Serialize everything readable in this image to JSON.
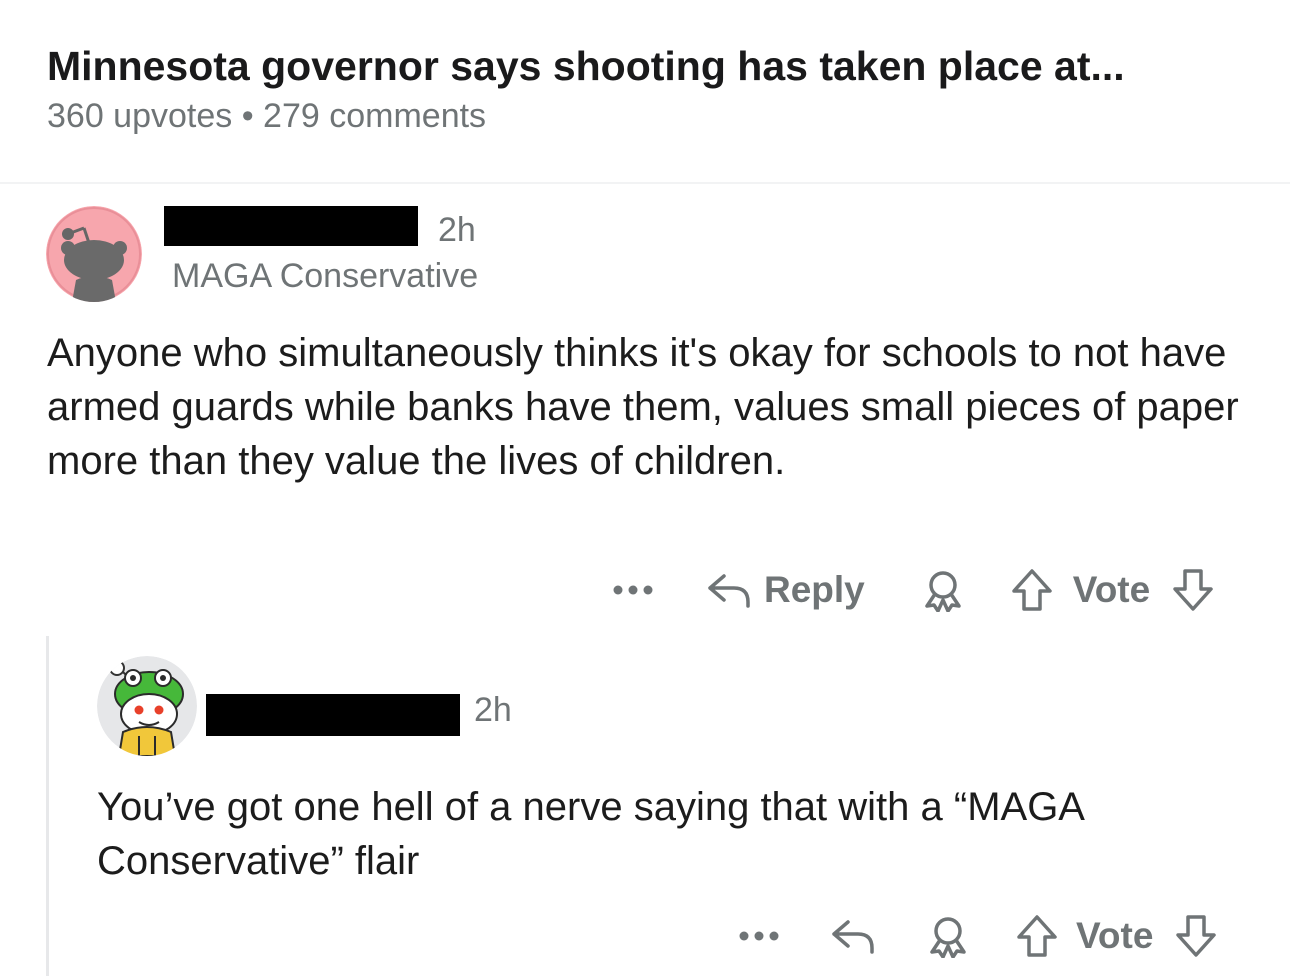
{
  "post": {
    "title": "Minnesota governor says shooting has taken place at...",
    "meta": "360 upvotes • 279 comments"
  },
  "comments": [
    {
      "username_redacted": true,
      "time": "2h",
      "flair": "MAGA Conservative",
      "body": "Anyone who simultaneously thinks it's okay for schools to not have armed guards while banks have them, values small pieces of paper more than they value the lives of children.",
      "actions": {
        "reply": "Reply",
        "vote": "Vote"
      }
    },
    {
      "username_redacted": true,
      "time": "2h",
      "body": "You’ve got one hell of a nerve saying that with a “MAGA Conservative” flair",
      "actions": {
        "vote": "Vote"
      }
    }
  ],
  "icons": [
    "more-icon",
    "reply-icon",
    "award-icon",
    "upvote-icon",
    "downvote-icon"
  ],
  "colors": {
    "meta_gray": "#6f7476",
    "avatar_pink": "#f7a6ad",
    "snoo_green": "#46b83a"
  }
}
